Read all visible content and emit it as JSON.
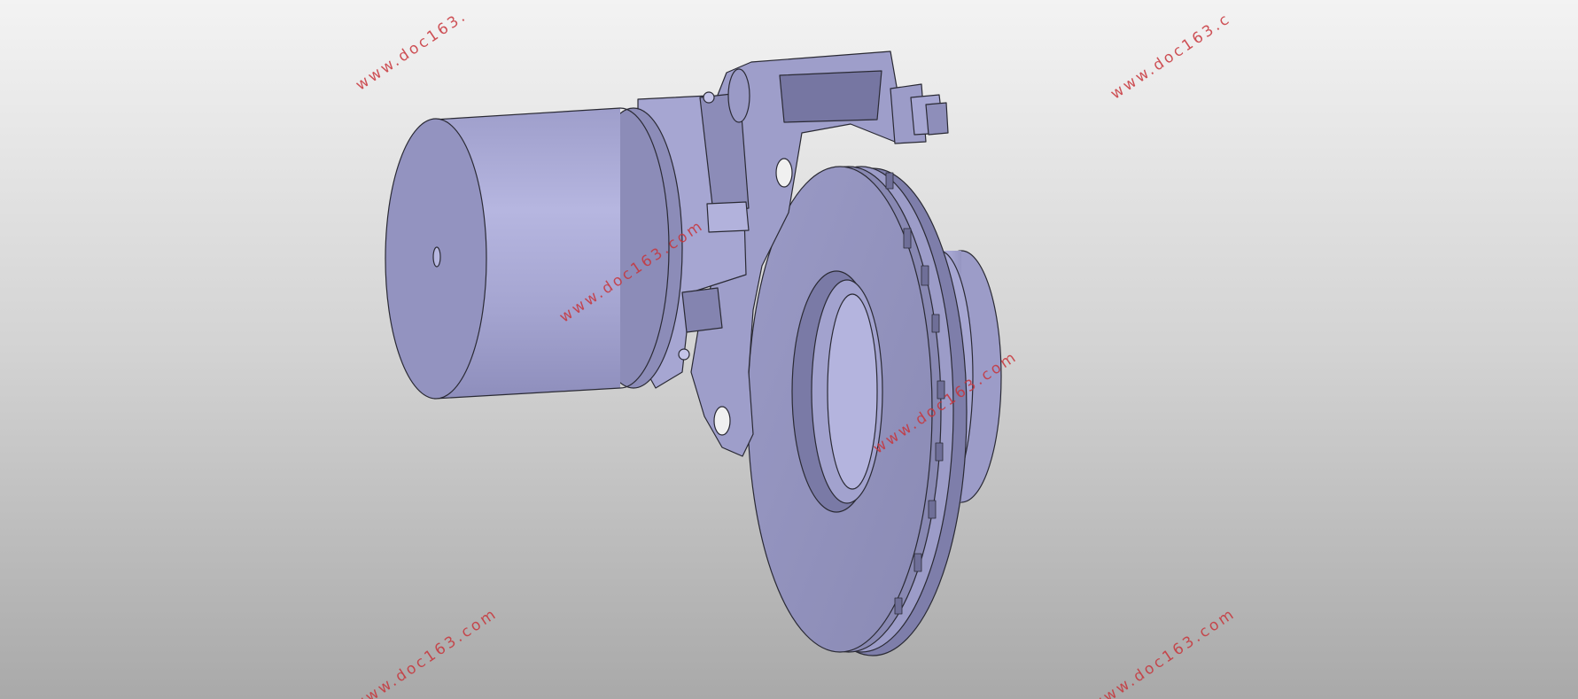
{
  "viewport": {
    "background": "#d3d3d3",
    "model_color": "#a8a8d4",
    "edge_color": "#2a2a34",
    "watermark_color": "#c8343a"
  },
  "watermarks": [
    "www.doc163.",
    "www.doc163.c",
    "www.doc163.com",
    "www.doc163.com",
    "www.doc163.com",
    "www.doc163.com"
  ]
}
